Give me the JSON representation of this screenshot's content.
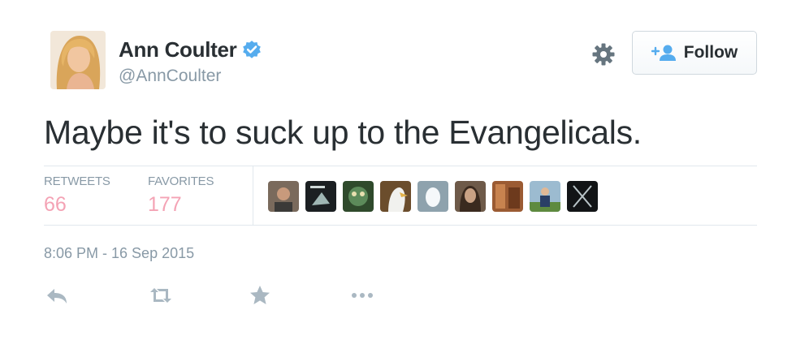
{
  "user": {
    "name": "Ann Coulter",
    "handle": "@AnnCoulter",
    "verified": true
  },
  "follow_button": {
    "label": "Follow"
  },
  "tweet": {
    "text": "Maybe it's to suck up to the Evangelicals."
  },
  "stats": {
    "retweets_label": "RETWEETS",
    "retweets_count": "66",
    "favorites_label": "FAVORITES",
    "favorites_count": "177"
  },
  "timestamp": "8:06 PM - 16 Sep 2015",
  "colors": {
    "text": "#292f33",
    "muted": "#8899a6",
    "count_pink": "#f4a3b5",
    "verified_blue": "#55acee",
    "border": "#e1e8ed"
  },
  "icons": {
    "settings": "gear-icon",
    "follow": "person-plus-icon",
    "reply": "reply-icon",
    "retweet": "retweet-icon",
    "favorite": "star-icon",
    "more": "more-dots-icon"
  }
}
